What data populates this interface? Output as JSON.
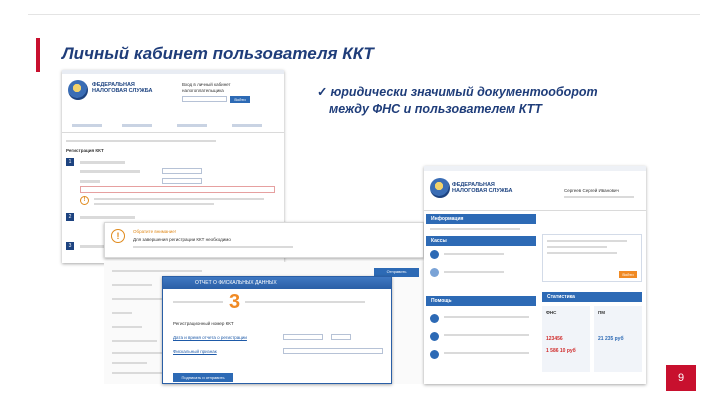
{
  "slide": {
    "title": "Личный кабинет пользователя ККТ",
    "callout_check": "✓",
    "callout_line1": "юридически значимый документооборот",
    "callout_line2": "между ФНС и пользователем КТТ",
    "page_number": "9"
  },
  "brand": {
    "logo_line1": "ФЕДЕРАЛЬНАЯ",
    "logo_line2": "НАЛОГОВАЯ СЛУЖБА"
  },
  "left_shot": {
    "header_tiny_1": "Вход в личный кабинет",
    "header_tiny_2": "налогоплательщика",
    "header_button": "Войти",
    "step_1": "1",
    "step_2": "2",
    "step_3": "3",
    "section_title": "Регистрация ККТ",
    "warning_text": "Обратите внимание!",
    "warning_body": "Для завершения регистрации ККТ необходимо"
  },
  "middle_dialog": {
    "header": "ОТЧЕТ О ФИСКАЛЬНЫХ ДАННЫХ",
    "big_number": "3",
    "field_label": "Регистрационный номер ККТ",
    "field_value": "",
    "link_1": "Дата и время отчета о регистрации",
    "link_2": "Фискальный признак",
    "button": "Подписать и отправить",
    "side_button": "Отправить"
  },
  "right_shot": {
    "user_name": "Сергеев Сергей Иванович",
    "panel_1": "Информация",
    "panel_2": "Кассы",
    "panel_3": "Помощь",
    "panel_4": "Статистика",
    "stat_1_label": "ФНС",
    "stat_2_label": "ПМ",
    "stat_values": [
      "123456",
      "1 586 10 руб",
      "21 235 руб"
    ],
    "btn_label": "Войти"
  },
  "colors": {
    "accent": "#c8102e",
    "title_blue": "#1f3d7a",
    "ui_blue": "#2d6ab5",
    "orange": "#f08a24"
  }
}
